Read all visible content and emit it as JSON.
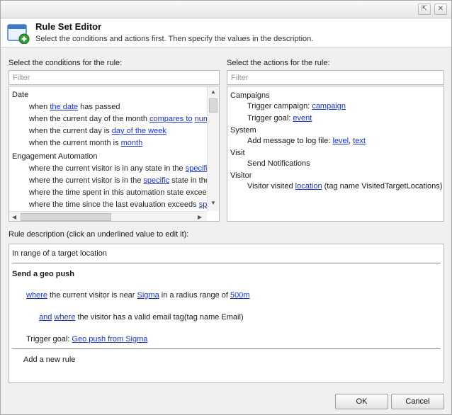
{
  "window": {
    "restore_glyph": "⇱",
    "close_glyph": "✕"
  },
  "header": {
    "title": "Rule Set Editor",
    "subtitle": "Select the conditions and actions first. Then specify the values in the description.",
    "icon": "window-add-icon"
  },
  "conditions": {
    "label": "Select the conditions for the rule:",
    "filter_placeholder": "Filter",
    "groups": [
      {
        "name": "Date",
        "items": [
          [
            "when ",
            "the date",
            " has passed"
          ],
          [
            "when the current day of the month ",
            "compares to",
            " ",
            "num"
          ],
          [
            "when the current day is ",
            "day of the week"
          ],
          [
            "when the current month is ",
            "month"
          ]
        ]
      },
      {
        "name": "Engagement Automation",
        "items": [
          [
            "where the current visitor is in any state in the ",
            "specifi"
          ],
          [
            "where the current visitor is in the ",
            "specific",
            " state in the"
          ],
          [
            "where the time spent in this automation state exceed"
          ],
          [
            "where the time since the last evaluation exceeds ",
            "spe"
          ]
        ]
      }
    ]
  },
  "actions": {
    "label": "Select the actions for the rule:",
    "filter_placeholder": "Filter",
    "groups": [
      {
        "name": "Campaigns"
      },
      {
        "name": "System"
      },
      {
        "name": "Visit"
      },
      {
        "name": "Visitor"
      }
    ],
    "items": {
      "trigger_campaign": "Trigger campaign: ",
      "trigger_campaign_link": "campaign",
      "trigger_goal": "Trigger goal: ",
      "trigger_goal_link": "event",
      "add_message": "Add message to log file: ",
      "add_message_level": "level",
      "add_message_sep": ", ",
      "add_message_text": "text",
      "send_notifications": "Send Notifications",
      "visitor_visited": "Visitor visited ",
      "visitor_visited_link": "location",
      "visitor_visited_tail": " (tag name VisitedTargetLocations)"
    }
  },
  "description": {
    "label": "Rule description (click an underlined value to edit it):",
    "rule_name": "In range of a target location",
    "rule_title": "Send a geo push",
    "line1": {
      "where": "where",
      "mid": " the current visitor is near ",
      "location": "Sigma",
      "mid2": " in a radius range of ",
      "radius": "500m"
    },
    "line2": {
      "and": "and",
      "space": " ",
      "where": "where",
      "tail": " the visitor has a valid email tag(tag name Email)"
    },
    "line3": {
      "prefix": "Trigger goal: ",
      "goal": "Geo push from Sigma"
    },
    "add_rule": "Add a new rule"
  },
  "buttons": {
    "ok": "OK",
    "cancel": "Cancel"
  }
}
